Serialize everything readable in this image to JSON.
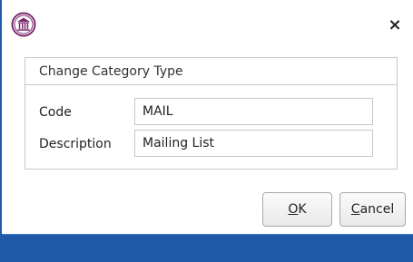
{
  "window": {
    "close_symbol": "×",
    "app_icon": "bank-building-icon",
    "accent_color": "#1f5aa8",
    "icon_color": "#7a2a6f"
  },
  "group": {
    "title": "Change Category Type"
  },
  "fields": {
    "code": {
      "label": "Code",
      "value": "MAIL"
    },
    "description": {
      "label": "Description",
      "value": "Mailing List"
    }
  },
  "buttons": {
    "ok": {
      "mnemonic": "O",
      "rest": "K"
    },
    "cancel": {
      "mnemonic": "C",
      "rest": "ancel"
    }
  }
}
